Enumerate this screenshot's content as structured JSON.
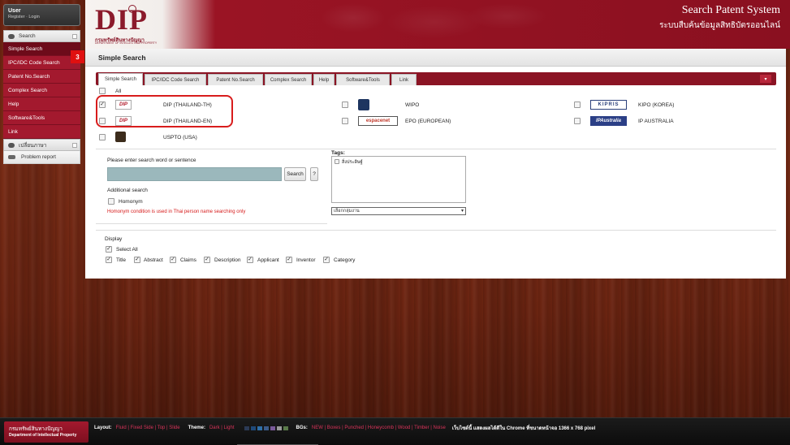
{
  "header": {
    "logo_text": "DIP",
    "logo_sub_th": "กรมทรัพย์สินทางปัญญา",
    "logo_sub_en": "DEPARTMENT OF INTELLECTUAL PROPERTY",
    "title": "Search Patent System",
    "subtitle": "ระบบสืบค้นข้อมูลสิทธิบัตรออนไลน์"
  },
  "sidebar": {
    "user_name": "User",
    "user_links": "Register · Login",
    "group_search": "Search",
    "items": [
      {
        "label": "Simple Search"
      },
      {
        "label": "IPC/IDC Code Search"
      },
      {
        "label": "Patent No.Search"
      },
      {
        "label": "Complex Search"
      },
      {
        "label": "Help"
      },
      {
        "label": "Software&Tools"
      },
      {
        "label": "Link"
      }
    ],
    "group_language": "เปลี่ยนภาษา",
    "problem_report": "Problem report"
  },
  "step_badge": "3",
  "panel": {
    "title": "Simple Search",
    "tabs": [
      {
        "label": "Simple Search"
      },
      {
        "label": "IPC/IDC Code Search"
      },
      {
        "label": "Patent No.Search"
      },
      {
        "label": "Complex Search"
      },
      {
        "label": "Help"
      },
      {
        "label": "Software&Tools"
      },
      {
        "label": "Link"
      }
    ],
    "tab_menu_icon": "▾",
    "all_label": "All",
    "databases": {
      "dip_th": {
        "label": "DIP (THAILAND-TH)",
        "logo": "DIP",
        "checked": true
      },
      "dip_en": {
        "label": "DIP (THAILAND-EN)",
        "logo": "DIP",
        "checked": false
      },
      "uspto": {
        "label": "USPTO (USA)",
        "logo": "USPTO",
        "checked": false
      },
      "wipo": {
        "label": "WIPO",
        "logo": "WIPO",
        "checked": false
      },
      "epo": {
        "label": "EPO (EUROPEAN)",
        "logo": "espacenet",
        "checked": false
      },
      "kipo": {
        "label": "KIPO (KOREA)",
        "logo": "KIPRIS",
        "checked": false
      },
      "ipaus": {
        "label": "IP AUSTRALIA",
        "logo": "IPAustralia",
        "checked": false
      }
    },
    "search_prompt": "Please enter search word or sentence",
    "search_value": "",
    "search_button": "Search",
    "help_button": "?",
    "additional_search": "Additional search",
    "homonym": "Homonym",
    "homonym_note": "Homonym condition is used in Thai person name searching only",
    "tags_label": "Tags:",
    "tag_item": "สิ่งประดิษฐ์",
    "select_value": "เลือกกลุ่มงาน",
    "display_label": "Display",
    "select_all": "Select All",
    "display_fields": [
      {
        "label": "Title"
      },
      {
        "label": "Abstract"
      },
      {
        "label": "Claims"
      },
      {
        "label": "Description"
      },
      {
        "label": "Applicant"
      },
      {
        "label": "Inventor"
      },
      {
        "label": "Category"
      }
    ],
    "check_mark": "✓"
  },
  "footer": {
    "logo_th": "กรมทรัพย์สินทางปัญญา",
    "logo_en": "Department of Intellectual Property",
    "layout_label": "Layout:",
    "layout_opts": "Fluid | Fixed   Side | Top | Slide",
    "theme_label": "Theme:",
    "theme_opts": "Dark | Light",
    "bgs_label": "BGs:",
    "bgs_opts": "NEW | Boxes | Punched | Honeycomb | Wood | Timber | Noise",
    "note": "เว็บไซต์นี้ แสดงผลได้ดีใน Chrome ที่ขนาดหน้าจอ 1366 x 768 pixel",
    "swatch_colors": [
      "#2b3a55",
      "#1f4a7a",
      "#2e6fa8",
      "#3b5b8a",
      "#7a5a9a",
      "#9a9a9a",
      "#5a7a4a"
    ]
  },
  "colors": {
    "brand_red": "#a3192e",
    "tab_bar": "#8b1424",
    "highlight": "#d81c1c",
    "search_input": "#9bb8bc"
  }
}
